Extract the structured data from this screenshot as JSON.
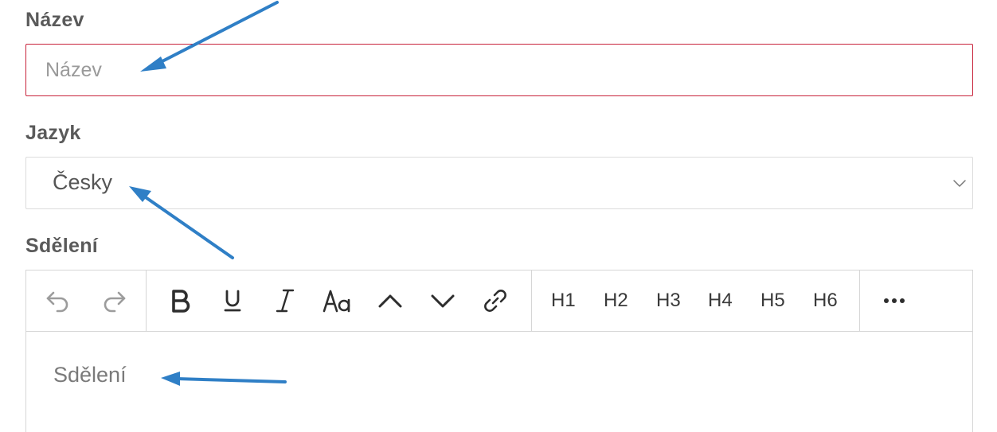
{
  "form": {
    "name_label": "Název",
    "name_placeholder": "Název",
    "language_label": "Jazyk",
    "language_value": "Česky",
    "message_label": "Sdělení",
    "message_placeholder": "Sdělení"
  },
  "toolbar": {
    "history": [
      "undo-icon",
      "redo-icon"
    ],
    "format_icons": [
      "bold-icon",
      "underline-icon",
      "italic-icon",
      "font-size-icon",
      "chevron-up-icon",
      "chevron-down-icon",
      "link-icon"
    ],
    "headings": [
      "H1",
      "H2",
      "H3",
      "H4",
      "H5",
      "H6"
    ],
    "more_icon": "more-icon"
  },
  "colors": {
    "invalid_border": "#c8223a",
    "annotation_arrow": "#2f7fc6",
    "label_text": "#5a5a5a",
    "border": "#d6d6d6"
  },
  "annotations": [
    "arrow-icon",
    "arrow-icon",
    "arrow-icon"
  ]
}
